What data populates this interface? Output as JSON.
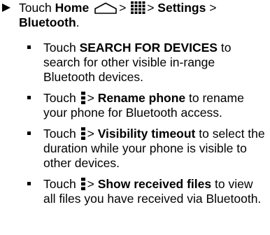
{
  "step": {
    "touch": "Touch",
    "home": "Home",
    "sep1": ">",
    "sep2": ">",
    "settings": "Settings",
    "sep3": ">",
    "bluetooth": "Bluetooth",
    "period": "."
  },
  "bullets": [
    {
      "pre": "Touch",
      "bold": "SEARCH FOR DEVICES",
      "post": "to search for other visible in-range Bluetooth devices."
    },
    {
      "pre": "Touch",
      "sep": ">",
      "bold": "Rename phone",
      "post": "to rename your phone for Bluetooth access."
    },
    {
      "pre": "Touch",
      "sep": ">",
      "bold": "Visibility timeout",
      "post": "to select the duration while your phone is visible to other devices."
    },
    {
      "pre": "Touch",
      "sep": ">",
      "bold": "Show received files",
      "post": "to view all files you have received via Bluetooth."
    }
  ],
  "icons": {
    "step_marker": "arrow-right-icon",
    "home": "home-icon",
    "apps": "apps-grid-icon",
    "menu": "menu-icon",
    "bullet": "square-bullet-icon"
  }
}
